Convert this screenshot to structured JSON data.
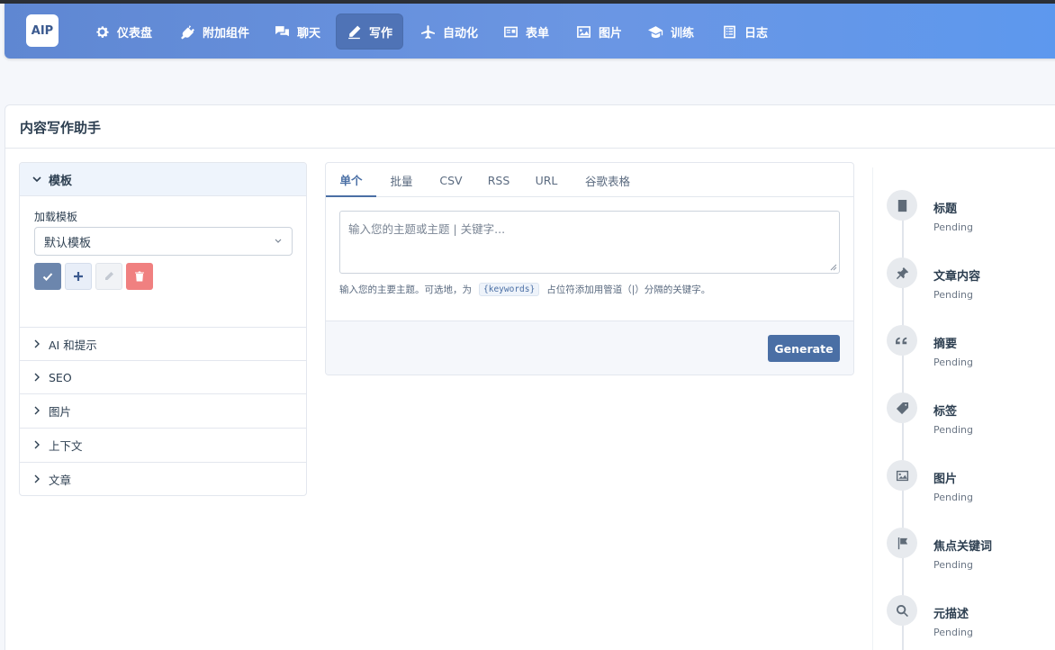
{
  "app": {
    "logo": "AIP"
  },
  "nav": [
    {
      "label": "仪表盘",
      "icon": "gear-icon"
    },
    {
      "label": "附加组件",
      "icon": "plug-icon"
    },
    {
      "label": "聊天",
      "icon": "chat-icon"
    },
    {
      "label": "写作",
      "icon": "pencil-icon",
      "active": true
    },
    {
      "label": "自动化",
      "icon": "plane-icon"
    },
    {
      "label": "表单",
      "icon": "form-icon"
    },
    {
      "label": "图片",
      "icon": "image-icon"
    },
    {
      "label": "训练",
      "icon": "graduation-cap-icon"
    },
    {
      "label": "日志",
      "icon": "list-icon"
    }
  ],
  "page": {
    "title": "内容写作助手"
  },
  "sidebar": {
    "open_section": "模板",
    "load_label": "加载模板",
    "template_value": "默认模板",
    "sections": [
      "AI 和提示",
      "SEO",
      "图片",
      "上下文",
      "文章"
    ]
  },
  "main": {
    "tabs": [
      "单个",
      "批量",
      "CSV",
      "RSS",
      "URL",
      "谷歌表格"
    ],
    "active_tab": "单个",
    "topic_placeholder": "输入您的主题或主题 | 关键字...",
    "help_before": "输入您的主要主题。可选地，为",
    "help_code": "{keywords}",
    "help_after": "占位符添加用管道（|）分隔的关键字。",
    "generate_label": "Generate"
  },
  "steps": [
    {
      "title": "标题",
      "status": "Pending",
      "icon": "document-icon"
    },
    {
      "title": "文章内容",
      "status": "Pending",
      "icon": "pin-icon"
    },
    {
      "title": "摘要",
      "status": "Pending",
      "icon": "quote-icon"
    },
    {
      "title": "标签",
      "status": "Pending",
      "icon": "tag-icon"
    },
    {
      "title": "图片",
      "status": "Pending",
      "icon": "image-icon"
    },
    {
      "title": "焦点关键词",
      "status": "Pending",
      "icon": "flag-icon"
    },
    {
      "title": "元描述",
      "status": "Pending",
      "icon": "search-icon"
    }
  ],
  "colors": {
    "accent": "#4a6fa5",
    "danger": "#f08080",
    "nav_gradient_start": "#5f87d2",
    "nav_gradient_end": "#5d98ee"
  }
}
